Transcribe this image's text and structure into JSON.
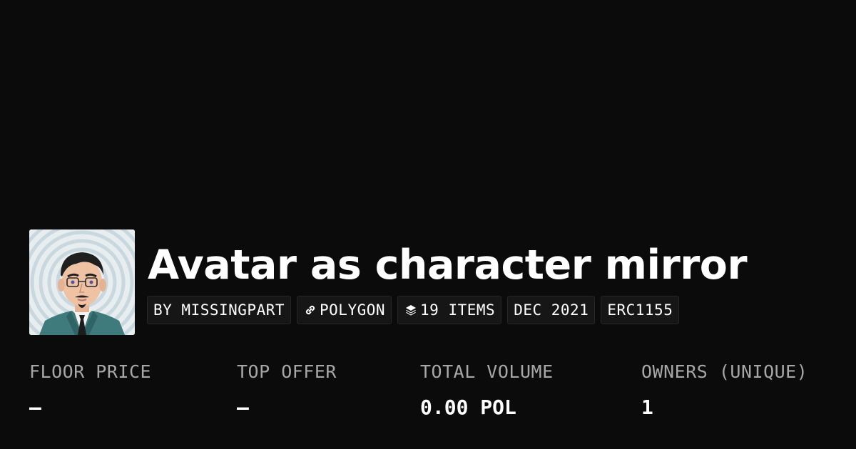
{
  "collection": {
    "title": "Avatar as character mirror",
    "avatar_alt": "collection-avatar-image"
  },
  "tags": [
    {
      "label": "BY MISSINGPART",
      "icon": null
    },
    {
      "label": "POLYGON",
      "icon": "chain-link-icon"
    },
    {
      "label": "19 ITEMS",
      "icon": "layers-icon"
    },
    {
      "label": "DEC 2021",
      "icon": null
    },
    {
      "label": "ERC1155",
      "icon": null
    }
  ],
  "stats": [
    {
      "label": "FLOOR PRICE",
      "value": "—"
    },
    {
      "label": "TOP OFFER",
      "value": "—"
    },
    {
      "label": "TOTAL VOLUME",
      "value": "0.00 POL"
    },
    {
      "label": "OWNERS (UNIQUE)",
      "value": "1"
    }
  ],
  "colors": {
    "background": "#0b0b0b",
    "tag_background": "#161616",
    "label_gray": "#a7a7a7",
    "text": "#ffffff"
  }
}
